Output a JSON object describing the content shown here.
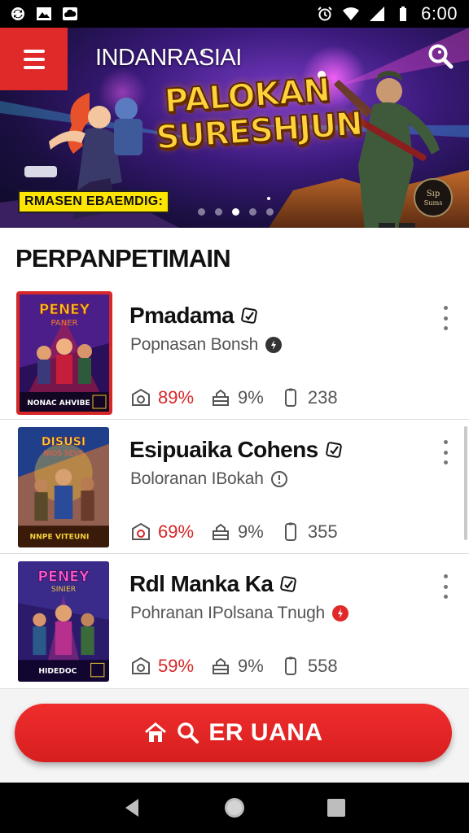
{
  "status_bar": {
    "time": "6:00",
    "left_icons": [
      "sync-icon",
      "image-icon",
      "cloud-icon"
    ],
    "right_icons": [
      "alarm-icon",
      "wifi-icon",
      "signal-icon",
      "battery-icon"
    ]
  },
  "header": {
    "app_title": "INDANRASIAI",
    "menu_icon": "menu-icon",
    "search_icon": "search-icon"
  },
  "banner": {
    "headline_line1": "PALOKAN",
    "headline_line2": "SURESHJUN",
    "tag": "RMASEN EBAEMDIG:",
    "slide_count": 5,
    "active_slide": 3,
    "seal_text": "Sıp Sums"
  },
  "section": {
    "title": "PERPANPETIMAIN"
  },
  "games": [
    {
      "name": "Pmadama",
      "subtitle": "Popnasan Bonsh",
      "sub_icon": "info-dark-icon",
      "rating": "89%",
      "share": "9%",
      "downloads": "238",
      "selected": true,
      "palette": [
        "#2a0f5a",
        "#c41e3a",
        "#f2c029"
      ]
    },
    {
      "name": "Esipuaika Cohens",
      "subtitle": "Boloranan IBokah",
      "sub_icon": "clock-outline-icon",
      "rating": "69%",
      "share": "9%",
      "downloads": "355",
      "selected": false,
      "palette": [
        "#1f3f8a",
        "#e0742a",
        "#f5d13a"
      ]
    },
    {
      "name": "Rdl Manka Ka",
      "subtitle": "Pohranan IPolsana Tnugh",
      "sub_icon": "info-red-icon",
      "rating": "59%",
      "share": "9%",
      "downloads": "558",
      "selected": false,
      "palette": [
        "#2c1b6b",
        "#b8308e",
        "#e8c23a"
      ]
    }
  ],
  "cta": {
    "label": "ER UANA",
    "icons": [
      "home-icon",
      "search-icon"
    ]
  },
  "nav": {
    "back": "back-icon",
    "home": "home-circle-icon",
    "recents": "recents-icon"
  },
  "colors": {
    "accent_red": "#d62828",
    "status_bar": "#000000",
    "text_primary": "#111111",
    "text_secondary": "#555555"
  }
}
